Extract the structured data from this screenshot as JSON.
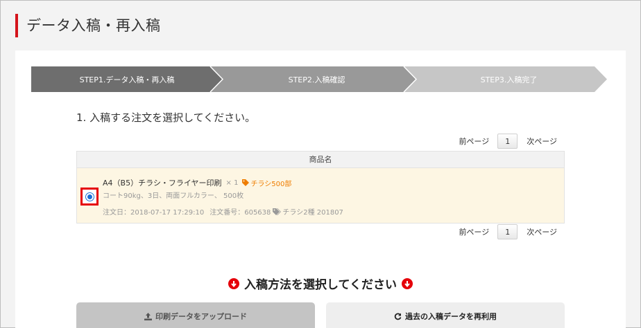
{
  "page": {
    "title": "データ入稿・再入稿"
  },
  "steps": [
    {
      "label": "STEP1.データ入稿・再入稿"
    },
    {
      "label": "STEP2.入稿確認"
    },
    {
      "label": "STEP3.入稿完了"
    }
  ],
  "instruction": "1. 入稿する注文を選択してください。",
  "pager": {
    "prev_label": "前ページ",
    "current_page": "1",
    "next_label": "次ページ"
  },
  "table": {
    "header": "商品名",
    "rows": [
      {
        "selected": true,
        "product_name": "A4（B5）チラシ・フライヤー印刷",
        "quantity": "× 1",
        "tag": "チラシ500部",
        "spec": "コート90kg、3日、両面フルカラー、 500枚",
        "order_date": "注文日：2018-07-17 17:29:10",
        "order_number": "注文番号：605638",
        "order_tag": "チラシ2種 201807"
      }
    ]
  },
  "method": {
    "heading": "入稿方法を選択してください",
    "upload_button": "印刷データをアップロード",
    "reuse_button": "過去の入稿データを再利用"
  },
  "colors": {
    "accent_red": "#e5000a",
    "tag_orange": "#ee7d00",
    "row_highlight": "#fdf6e3",
    "radio_blue": "#1a6fd6"
  },
  "icons": {
    "tag": "tag-icon",
    "down_arrow": "arrow-circle-down-icon",
    "upload": "upload-icon",
    "refresh": "refresh-icon"
  }
}
